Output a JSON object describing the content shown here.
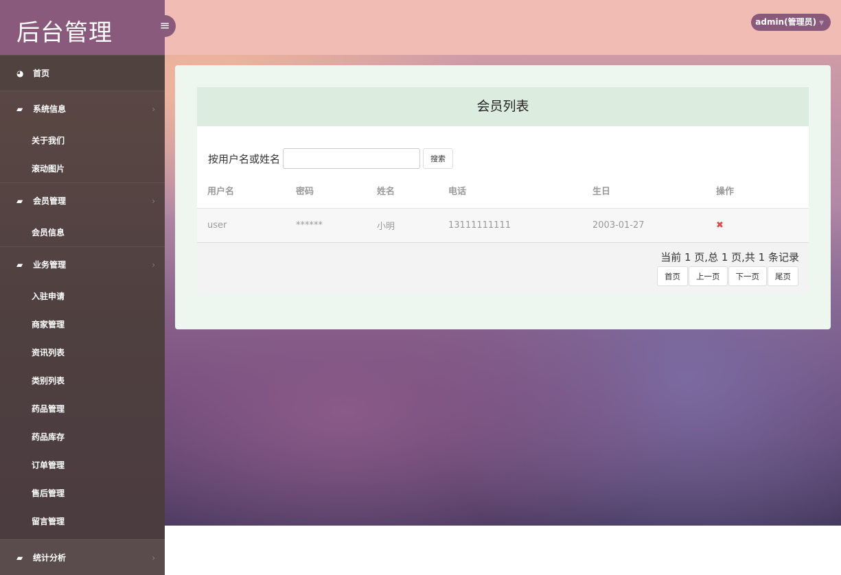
{
  "brand": "后台管理",
  "user": "admin(管理员)",
  "sidebar": {
    "home": "首页",
    "groups": [
      {
        "label": "系统信息",
        "items": [
          "关于我们",
          "滚动图片"
        ]
      },
      {
        "label": "会员管理",
        "items": [
          "会员信息"
        ]
      },
      {
        "label": "业务管理",
        "items": [
          "入驻申请",
          "商家管理",
          "资讯列表",
          "类别列表",
          "药品管理",
          "药品库存",
          "订单管理",
          "售后管理",
          "留言管理"
        ]
      },
      {
        "label": "统计分析",
        "items": []
      }
    ]
  },
  "main": {
    "title": "会员列表",
    "search_label": "按用户名或姓名",
    "search_value": "",
    "search_button": "搜索",
    "columns": [
      "用户名",
      "密码",
      "姓名",
      "电话",
      "生日",
      "操作"
    ],
    "rows": [
      [
        "user",
        "******",
        "小明",
        "13111111111",
        "2003-01-27"
      ]
    ],
    "delete_icon": "✖",
    "page_info": "当前 1 页,总 1 页,共 1 条记录",
    "pager": [
      "首页",
      "上一页",
      "下一页",
      "尾页"
    ]
  }
}
